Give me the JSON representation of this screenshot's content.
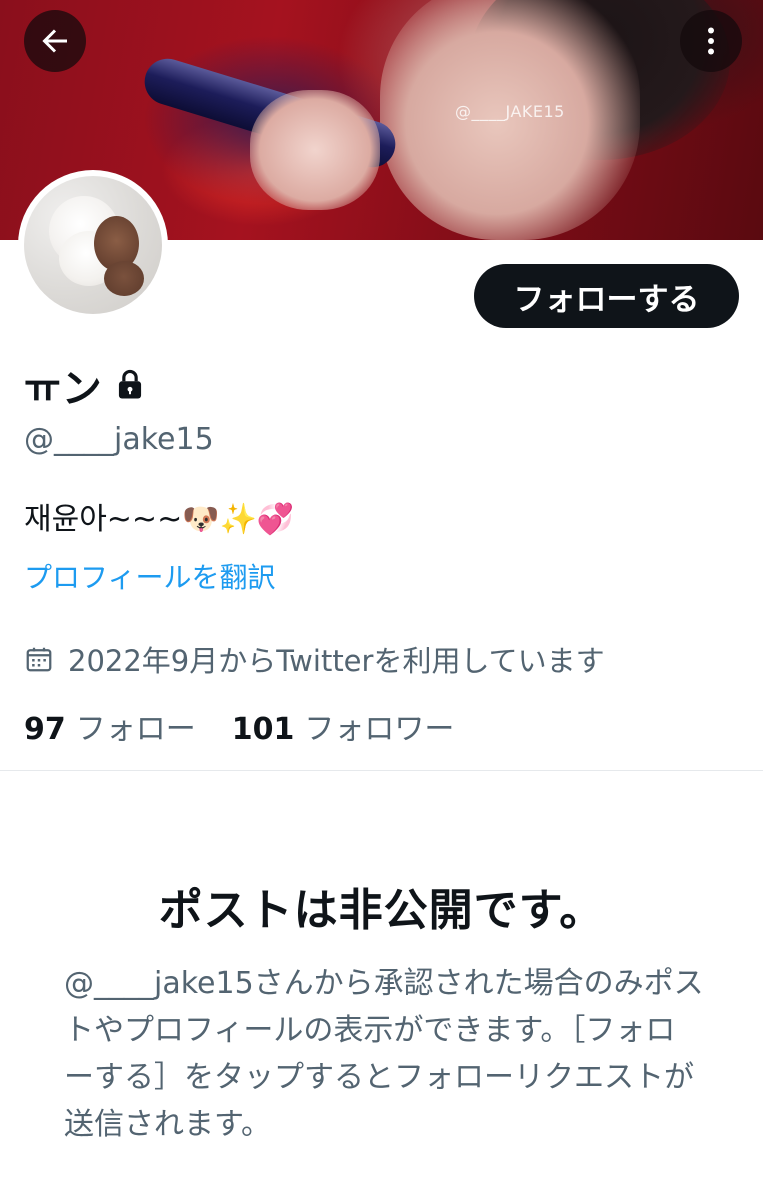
{
  "header": {
    "banner_watermark": "@____JAKE15",
    "back_icon": "arrow-left-icon",
    "more_icon": "more-vertical-icon"
  },
  "profile": {
    "display_name": "ㅠン",
    "lock_icon": "lock-icon",
    "handle": "@____jake15",
    "bio": "재윤아~~~🐶✨💞",
    "translate_label": "プロフィールを翻訳",
    "joined_text": "2022年9月からTwitterを利用しています",
    "calendar_icon": "calendar-icon",
    "follow_button_label": "フォローする",
    "following_count": "97",
    "following_label": "フォロー",
    "followers_count": "101",
    "followers_label": "フォロワー"
  },
  "private_notice": {
    "title": "ポストは非公開です。",
    "body": "@____jake15さんから承認された場合のみポストやプロフィールの表示ができます。［フォローする］をタップするとフォローリクエストが送信されます。"
  },
  "colors": {
    "text_primary": "#0f1419",
    "text_secondary": "#536471",
    "link": "#1d9bf0",
    "button_bg": "#0f1419"
  }
}
